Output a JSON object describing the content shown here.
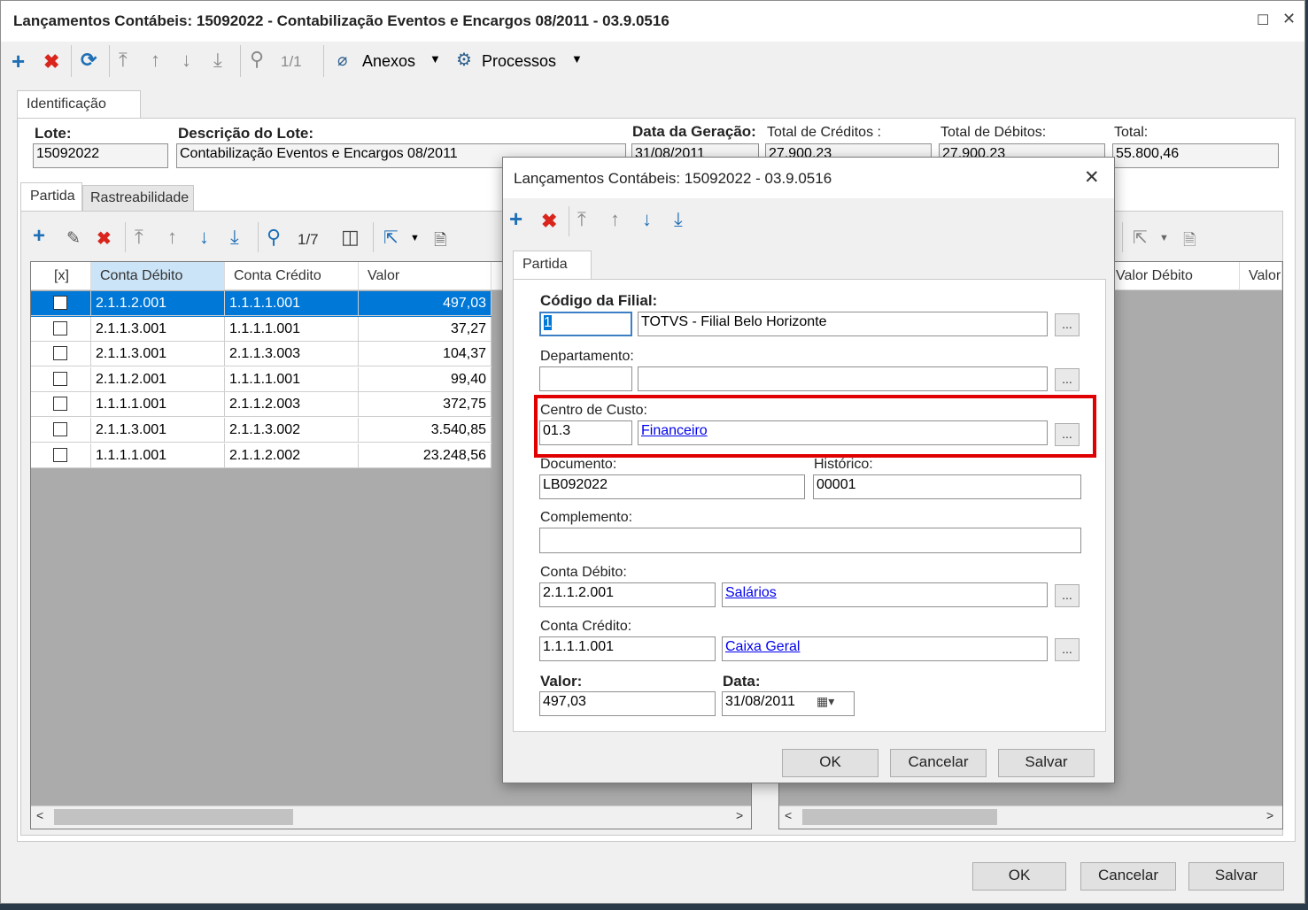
{
  "main": {
    "title": "Lançamentos Contábeis: 15092022 - Contabilização Eventos e Encargos 08/2011 - 03.9.0516",
    "maximize_icon": "maximize-icon",
    "close_icon": "close-icon",
    "toolbar": {
      "page": "1/1",
      "attachments": "Anexos",
      "processes": "Processos"
    },
    "tab_identificacao": "Identificação",
    "lote_label": "Lote:",
    "lote_value": "15092022",
    "descricao_label": "Descrição do Lote:",
    "descricao_value": "Contabilização Eventos e Encargos 08/2011",
    "data_geracao_label": "Data da Geração:",
    "data_geracao_value": "31/08/2011",
    "total_creditos_label": "Total de Créditos :",
    "total_creditos_value": "27.900,23",
    "total_debitos_label": "Total de Débitos:",
    "total_debitos_value": "27.900,23",
    "total_label": "Total:",
    "total_value": "55.800,46",
    "subtabs": [
      "Partida",
      "Rastreabilidade"
    ],
    "grid_page": "1/7",
    "grid_columns": [
      "[x]",
      "Conta Débito",
      "Conta Crédito",
      "Valor"
    ],
    "right_grid_columns": [
      "Valor Débito",
      "Valor"
    ],
    "rows": [
      {
        "debito": "2.1.1.2.001",
        "credito": "1.1.1.1.001",
        "valor": "497,03"
      },
      {
        "debito": "2.1.1.3.001",
        "credito": "1.1.1.1.001",
        "valor": "37,27"
      },
      {
        "debito": "2.1.1.3.001",
        "credito": "2.1.1.3.003",
        "valor": "104,37"
      },
      {
        "debito": "2.1.1.2.001",
        "credito": "1.1.1.1.001",
        "valor": "99,40"
      },
      {
        "debito": "1.1.1.1.001",
        "credito": "2.1.1.2.003",
        "valor": "372,75"
      },
      {
        "debito": "2.1.1.3.001",
        "credito": "2.1.1.3.002",
        "valor": "3.540,85"
      },
      {
        "debito": "1.1.1.1.001",
        "credito": "2.1.1.2.002",
        "valor": "23.248,56"
      }
    ],
    "ok": "OK",
    "cancel": "Cancelar",
    "save": "Salvar"
  },
  "dialog": {
    "title": "Lançamentos Contábeis: 15092022 - 03.9.0516",
    "tab": "Partida",
    "filial_label": "Código da Filial:",
    "filial_code": "1",
    "filial_name": "TOTVS - Filial Belo Horizonte",
    "departamento_label": "Departamento:",
    "departamento_code": "",
    "departamento_name": "",
    "centro_label": "Centro de Custo:",
    "centro_code": "01.3",
    "centro_name": "Financeiro",
    "documento_label": "Documento:",
    "documento_value": "LB092022",
    "historico_label": "Histórico:",
    "historico_value": "00001",
    "complemento_label": "Complemento:",
    "complemento_value": "",
    "conta_debito_label": "Conta Débito:",
    "conta_debito_code": "2.1.1.2.001",
    "conta_debito_name": "Salários",
    "conta_credito_label": "Conta Crédito:",
    "conta_credito_code": "1.1.1.1.001",
    "conta_credito_name": "Caixa Geral",
    "valor_label": "Valor:",
    "valor_value": "497,03",
    "data_label": "Data:",
    "data_value": "31/08/2011",
    "dots": "...",
    "ok": "OK",
    "cancel": "Cancelar",
    "save": "Salvar"
  },
  "colors": {
    "selection": "#0078d7",
    "highlight_border": "#e00000",
    "link": "#0000ee"
  }
}
